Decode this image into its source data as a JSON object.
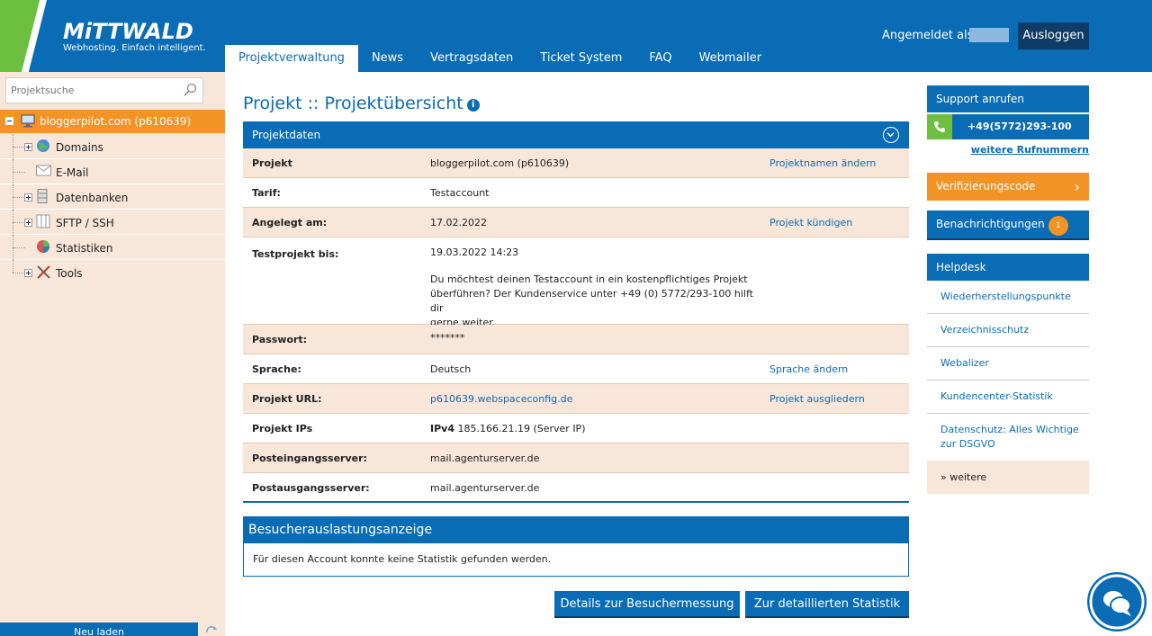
{
  "brand": {
    "name": "MiTTWALD",
    "tagline": "Webhosting. Einfach intelligent."
  },
  "nav": {
    "tabs": [
      "Projektverwaltung",
      "News",
      "Vertragsdaten",
      "Ticket System",
      "FAQ",
      "Webmailer"
    ],
    "active": "Projektverwaltung"
  },
  "account": {
    "logged_in_label": "Angemeldet als:",
    "logout_label": "Ausloggen"
  },
  "sidebar": {
    "search_placeholder": "Projektsuche",
    "root": "bloggerpilot.com (p610639)",
    "items": [
      {
        "label": "Domains",
        "icon": "globe-icon",
        "expandable": true
      },
      {
        "label": "E-Mail",
        "icon": "envelope-icon",
        "expandable": false
      },
      {
        "label": "Datenbanken",
        "icon": "database-icon",
        "expandable": true
      },
      {
        "label": "SFTP / SSH",
        "icon": "folder-icon",
        "expandable": true
      },
      {
        "label": "Statistiken",
        "icon": "pie-chart-icon",
        "expandable": false
      },
      {
        "label": "Tools",
        "icon": "tools-icon",
        "expandable": true
      }
    ],
    "reload_label": "Neu laden"
  },
  "main": {
    "title": "Projekt :: Projektübersicht",
    "panel_title": "Projektdaten",
    "rows": {
      "projekt": {
        "key": "Projekt",
        "value": "bloggerpilot.com (p610639)",
        "action": "Projektnamen ändern"
      },
      "tarif": {
        "key": "Tarif:",
        "value": "Testaccount"
      },
      "angelegt": {
        "key": "Angelegt am:",
        "value": "17.02.2022",
        "action": "Projekt kündigen"
      },
      "testprojekt": {
        "key": "Testprojekt bis:",
        "value": "19.03.2022 14:23",
        "note_1": "Du möchtest deinen Testaccount in ein kostenpflichtiges Projekt",
        "note_2": "überführen? Der Kundenservice unter +49 (0) 5772/293-100 hilft dir",
        "note_3": "gerne weiter."
      },
      "passwort": {
        "key": "Passwort:",
        "value": "*******"
      },
      "sprache": {
        "key": "Sprache:",
        "value": "Deutsch",
        "action": "Sprache ändern"
      },
      "url": {
        "key": "Projekt URL:",
        "value": "p610639.webspaceconfig.de",
        "action": "Projekt ausgliedern"
      },
      "ips": {
        "key": "Projekt IPs",
        "value_label": "IPv4",
        "value": "185.166.21.19 (Server IP)"
      },
      "posteingang": {
        "key": "Posteingangsserver:",
        "value": "mail.agenturserver.de"
      },
      "postausgang": {
        "key": "Postausgangsserver:",
        "value": "mail.agenturserver.de"
      }
    },
    "visitor_title": "Besucherauslastungsanzeige",
    "visitor_text": "Für diesen Account konnte keine Statistik gefunden werden.",
    "btn_details": "Details zur Besuchermessung",
    "btn_stats": "Zur detaillierten Statistik"
  },
  "right": {
    "support_title": "Support anrufen",
    "phone": "+49(5772)293-100",
    "more_phones": "weitere Rufnummern",
    "verify": "Verifizierungscode",
    "notifications": "Benachrichtigungen",
    "notifications_count": "1",
    "helpdesk_title": "Helpdesk",
    "helpdesk_items": [
      "Wiederherstellungspunkte",
      "Verzeichnisschutz",
      "Webalizer",
      "Kundencenter-Statistik"
    ],
    "helpdesk_dsgvo_1": "Datenschutz: Alles Wichtige",
    "helpdesk_dsgvo_2": "zur DSGVO",
    "more": "» weitere"
  },
  "colors": {
    "primary": "#0a6cb5",
    "accent": "#f29325",
    "green": "#6dbf3f",
    "panel_bg": "#f8e6d9",
    "dark": "#0f3c66"
  }
}
